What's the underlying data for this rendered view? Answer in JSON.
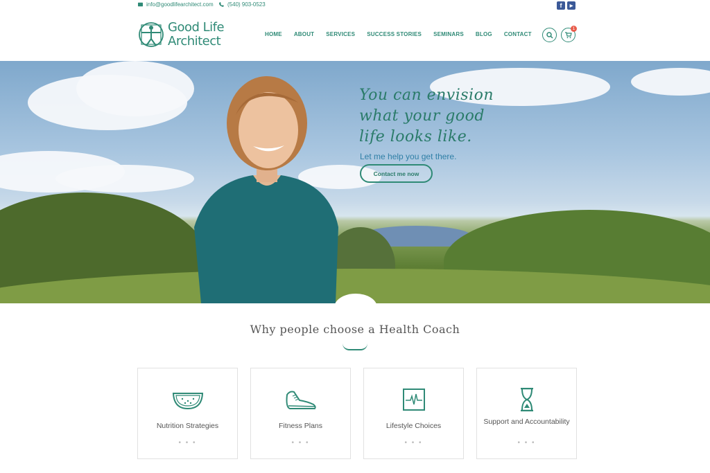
{
  "topbar": {
    "email": "info@goodlifearchitect.com",
    "phone": "(540) 903-0523"
  },
  "social": [
    "facebook-icon",
    "youtube-icon"
  ],
  "logo": {
    "line1": "Good Life",
    "line2": "Architect"
  },
  "nav": [
    "HOME",
    "ABOUT",
    "SERVICES",
    "SUCCESS STORIES",
    "SEMINARS",
    "BLOG",
    "CONTACT"
  ],
  "cart": {
    "count": "1"
  },
  "hero": {
    "headline_1": "You can envision",
    "headline_2": "what your good",
    "headline_3": "life looks like.",
    "subline": "Let me help you get there.",
    "cta": "Contact me now"
  },
  "section": {
    "title": "Why people choose a Health Coach"
  },
  "cards": [
    {
      "icon": "watermelon-icon",
      "label": "Nutrition Strategies",
      "dots": "• • •"
    },
    {
      "icon": "sneaker-icon",
      "label": "Fitness Plans",
      "dots": "• • •"
    },
    {
      "icon": "heart-monitor-icon",
      "label": "Lifestyle Choices",
      "dots": "• • •"
    },
    {
      "icon": "hourglass-icon",
      "label": "Support and Accountability",
      "dots": "• • •"
    }
  ],
  "colors": {
    "accent": "#2f8a76",
    "headline": "#2a7b69",
    "badge": "#e85c4b"
  }
}
